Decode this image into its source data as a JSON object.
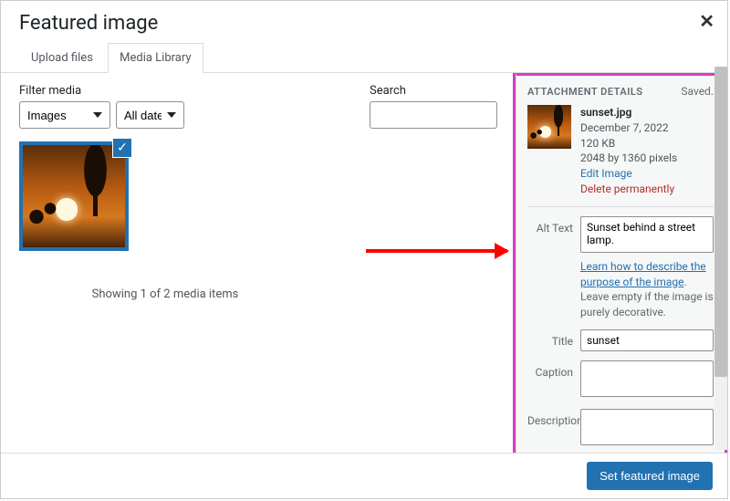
{
  "header": {
    "title": "Featured image"
  },
  "tabs": {
    "upload": "Upload files",
    "library": "Media Library"
  },
  "filters": {
    "media_label": "Filter media",
    "media_value": "Images",
    "dates_value": "All dates",
    "search_label": "Search"
  },
  "status": "Showing 1 of 2 media items",
  "sidebar": {
    "title": "ATTACHMENT DETAILS",
    "saved": "Saved.",
    "filename": "sunset.jpg",
    "date": "December 7, 2022",
    "filesize": "120 KB",
    "dimensions": "2048 by 1360 pixels",
    "edit": "Edit Image",
    "delete": "Delete permanently",
    "alt_label": "Alt Text",
    "alt_value": "Sunset behind a street lamp.",
    "alt_help_link": "Learn how to describe the purpose of the image",
    "alt_help_rest": ". Leave empty if the image is purely decorative.",
    "title_label": "Title",
    "title_value": "sunset",
    "caption_label": "Caption",
    "caption_value": "",
    "description_label": "Description",
    "description_value": ""
  },
  "footer": {
    "button": "Set featured image"
  }
}
